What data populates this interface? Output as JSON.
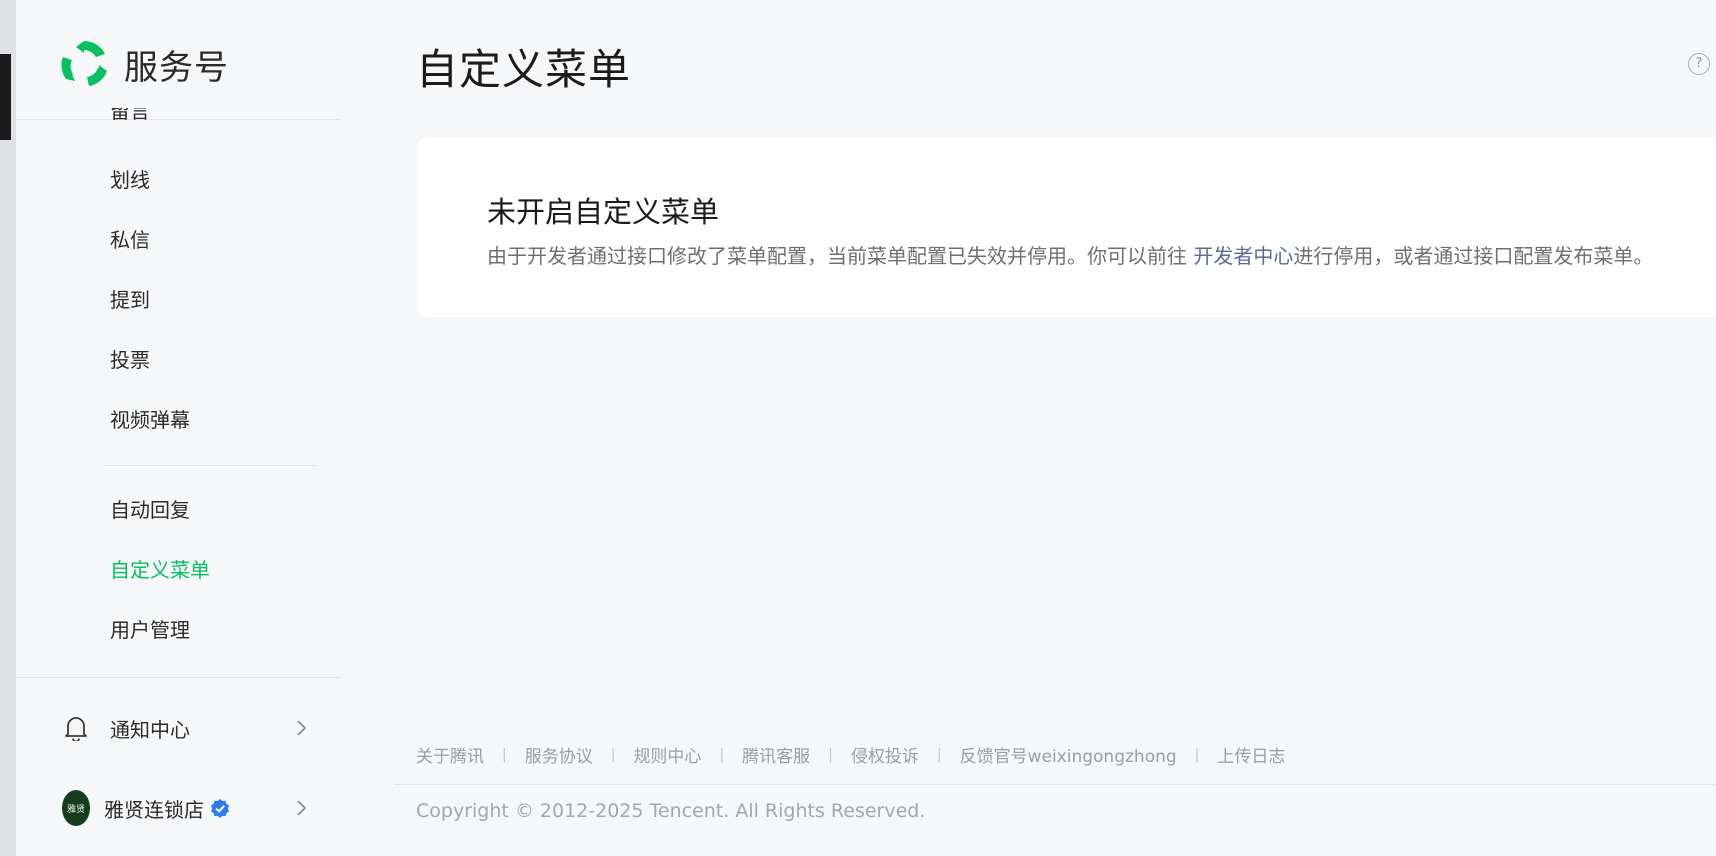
{
  "brand": {
    "name": "服务号",
    "accent": "#07c160"
  },
  "sidebar": {
    "items": [
      {
        "label": "留言"
      },
      {
        "label": "划线"
      },
      {
        "label": "私信"
      },
      {
        "label": "提到"
      },
      {
        "label": "投票"
      },
      {
        "label": "视频弹幕"
      },
      {
        "label": "自动回复"
      },
      {
        "label": "自定义菜单",
        "active": true
      },
      {
        "label": "用户管理"
      }
    ],
    "notification": {
      "label": "通知中心",
      "icon": "bell-icon"
    },
    "account": {
      "name": "雅贤连锁店",
      "verified_icon": "verified-badge-icon",
      "avatar_text": "雅贤"
    }
  },
  "page": {
    "title": "自定义菜单",
    "help_icon": "?"
  },
  "card": {
    "title": "未开启自定义菜单",
    "desc_before": "由于开发者通过接口修改了菜单配置，当前菜单配置已失效并停用。你可以前往 ",
    "link": "开发者中心",
    "desc_after": "进行停用，或者通过接口配置发布菜单。"
  },
  "footer": {
    "links": [
      "关于腾讯",
      "服务协议",
      "规则中心",
      "腾讯客服",
      "侵权投诉",
      "反馈官号weixingongzhong",
      "上传日志"
    ],
    "separator": "|",
    "copyright": "Copyright © 2012-2025 Tencent. All Rights Reserved."
  },
  "colors": {
    "active": "#07c160",
    "link": "#576b95",
    "background": "#f6f7f9"
  }
}
